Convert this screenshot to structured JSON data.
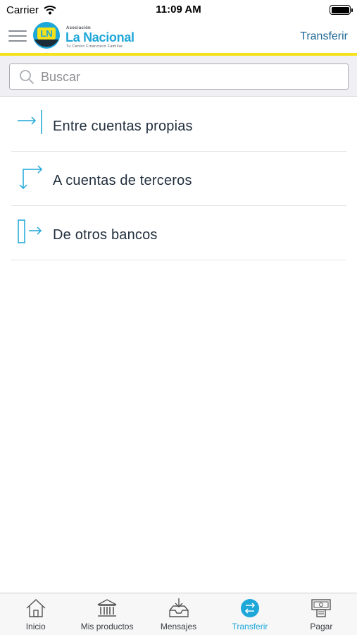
{
  "status_bar": {
    "carrier": "Carrier",
    "time": "11:09 AM"
  },
  "header": {
    "logo": {
      "small_text": "Asociación",
      "title": "La Nacional",
      "tagline": "Tu Centro Financiero Familiar",
      "badge_text": "LN"
    },
    "title": "Transferir"
  },
  "search": {
    "placeholder": "Buscar",
    "value": ""
  },
  "transfer_options": [
    {
      "label": "Entre cuentas propias",
      "icon": "arrow-right-bar-icon"
    },
    {
      "label": "A cuentas de terceros",
      "icon": "corner-arrows-icon"
    },
    {
      "label": "De otros bancos",
      "icon": "bank-transfer-icon"
    }
  ],
  "tab_bar": {
    "tabs": [
      {
        "label": "Inicio",
        "icon": "home-icon"
      },
      {
        "label": "Mis productos",
        "icon": "bank-icon"
      },
      {
        "label": "Mensajes",
        "icon": "inbox-icon"
      },
      {
        "label": "Transferir",
        "icon": "transfer-icon",
        "active": true
      },
      {
        "label": "Pagar",
        "icon": "pay-icon"
      }
    ]
  },
  "colors": {
    "accent": "#1ea7d9",
    "header_text": "#1d6796",
    "yellow_line": "#f5e21a"
  }
}
